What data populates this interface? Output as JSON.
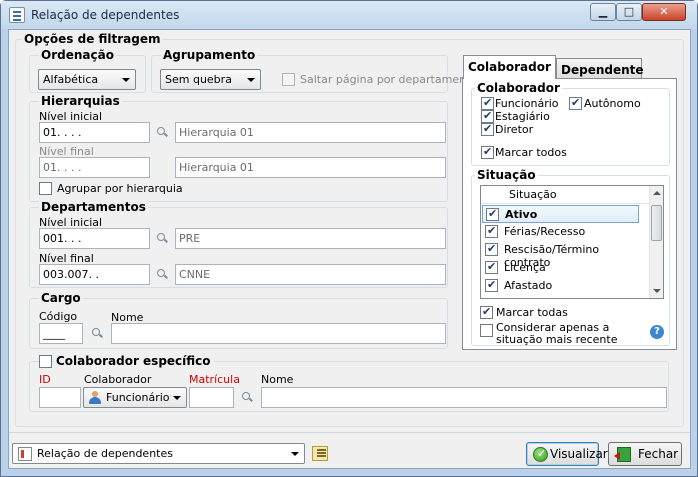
{
  "window": {
    "title": "Relação de dependentes"
  },
  "filters": {
    "title": "Opções de filtragem",
    "ordenacao": {
      "title": "Ordenação",
      "selected": "Alfabética"
    },
    "agrupamento": {
      "title": "Agrupamento",
      "selected": "Sem quebra",
      "saltar_label": "Saltar página por departamento"
    },
    "hierarquias": {
      "title": "Hierarquias",
      "nivel_inicial_label": "Nível inicial",
      "nivel_inicial_code": "01.   .   .   .",
      "nivel_inicial_name": "Hierarquia 01",
      "nivel_final_label": "Nível final",
      "nivel_final_code": "01.   .   .   .",
      "nivel_final_name": "Hierarquia 01",
      "agrupar_label": "Agrupar por hierarquia"
    },
    "departamentos": {
      "title": "Departamentos",
      "nivel_inicial_label": "Nível inicial",
      "nivel_inicial_code": "001.   .   .",
      "nivel_inicial_name": "PRE",
      "nivel_final_label": "Nível final",
      "nivel_final_code": "003.007.   .",
      "nivel_final_name": "CNNE"
    },
    "cargo": {
      "title": "Cargo",
      "codigo_label": "Código",
      "codigo_value": "____",
      "nome_label": "Nome"
    },
    "colaborador_especifico": {
      "title": "Colaborador específico",
      "id_label": "ID",
      "colaborador_label": "Colaborador",
      "colaborador_value": "Funcionário",
      "matricula_label": "Matrícula",
      "nome_label": "Nome"
    }
  },
  "tabs": [
    {
      "label": "Colaborador"
    },
    {
      "label": "Dependente"
    }
  ],
  "colaborador_tab": {
    "group_title": "Colaborador",
    "types": [
      {
        "label": "Funcionário",
        "checked": true
      },
      {
        "label": "Autônomo",
        "checked": true
      },
      {
        "label": "Estagiário",
        "checked": true
      },
      {
        "label": "Diretor",
        "checked": true
      }
    ],
    "marcar_todos": "Marcar todos",
    "situacao": {
      "title": "Situação",
      "list_header": "Situação",
      "items": [
        {
          "label": "Ativo",
          "checked": true
        },
        {
          "label": "Férias/Recesso",
          "checked": true
        },
        {
          "label": "Rescisão/Término contrato",
          "checked": true
        },
        {
          "label": "Licença",
          "checked": true
        },
        {
          "label": "Afastado",
          "checked": true
        }
      ],
      "marcar_todas": "Marcar todas",
      "considerar": "Considerar apenas a situação mais recente"
    }
  },
  "bottom": {
    "report_selected": "Relação de dependentes",
    "visualizar": "Visualizar",
    "fechar": "Fechar"
  }
}
